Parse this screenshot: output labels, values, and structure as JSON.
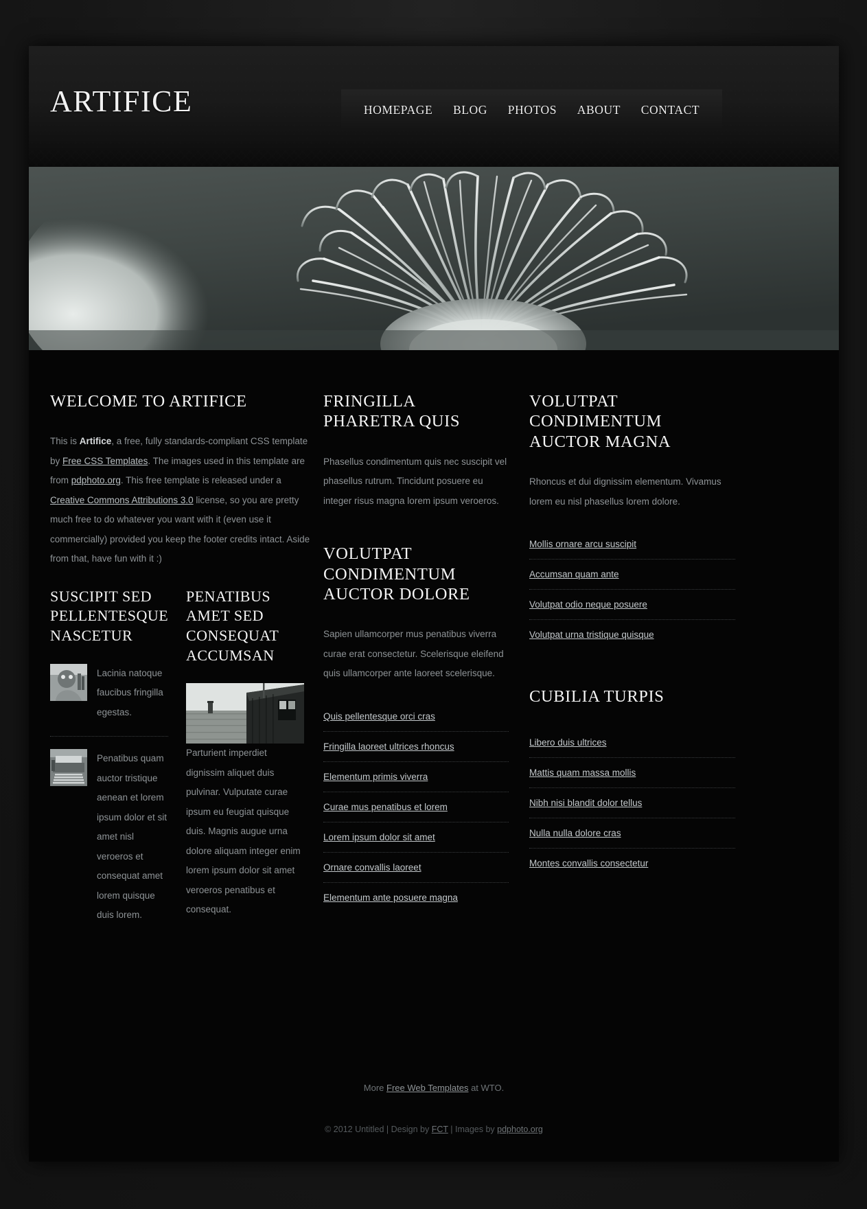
{
  "site": {
    "logo": "ARTIFICE"
  },
  "nav": {
    "items": [
      {
        "label": "HOMEPAGE"
      },
      {
        "label": "BLOG"
      },
      {
        "label": "PHOTOS"
      },
      {
        "label": "ABOUT"
      },
      {
        "label": "CONTACT"
      }
    ]
  },
  "banner": {
    "alt": "black and white macro photo of a pincushion protea flower"
  },
  "welcome": {
    "heading": "WELCOME TO ARTIFICE",
    "text_1": "This is ",
    "bold_1": "Artifice",
    "text_2": ", a free, fully standards-compliant CSS template by ",
    "link_1": "Free CSS Templates",
    "text_3": ". The images used in this template are from ",
    "link_2": "pdphoto.org",
    "text_4": ". This free template is released under a ",
    "link_3": "Creative Commons Attributions 3.0",
    "text_5": " license, so you are pretty much free to do whatever you want with it (even use it commercially) provided you keep the footer credits intact. Aside from that, have fun with it :)"
  },
  "left_blocks": [
    {
      "heading": "SUSCIPIT SED PELLENTESQUE NASCETUR",
      "items": [
        {
          "thumb": "statue-thumbnail",
          "text": "Lacinia natoque faucibus fringilla egestas."
        },
        {
          "thumb": "typewriter-thumbnail",
          "text": "Penatibus quam auctor tristique aenean et lorem ipsum dolor et sit amet nisl veroeros et consequat amet lorem quisque duis lorem."
        }
      ]
    },
    {
      "heading": "PENATIBUS AMET SED CONSEQUAT ACCUMSAN",
      "image": "barn-photo",
      "paragraph": "Parturient imperdiet dignissim aliquet duis pulvinar. Vulputate curae ipsum eu feugiat quisque duis. Magnis augue urna dolore aliquam integer enim lorem ipsum dolor sit amet veroeros penatibus et consequat."
    }
  ],
  "middle": {
    "block1": {
      "heading": "FRINGILLA PHARETRA QUIS",
      "paragraph": "Phasellus condimentum quis nec suscipit vel phasellus rutrum. Tincidunt posuere eu integer risus magna lorem ipsum veroeros."
    },
    "block2": {
      "heading": "VOLUTPAT CONDIMENTUM AUCTOR DOLORE",
      "paragraph": "Sapien ullamcorper mus penatibus viverra curae erat consectetur. Scelerisque eleifend quis ullamcorper ante laoreet scelerisque.",
      "links": [
        "Quis pellentesque orci cras",
        "Fringilla laoreet ultrices rhoncus",
        "Elementum primis viverra",
        "Curae mus penatibus et lorem",
        "Lorem ipsum dolor sit amet",
        "Ornare convallis laoreet",
        "Elementum ante posuere magna"
      ]
    }
  },
  "right": {
    "block1": {
      "heading": "VOLUTPAT CONDIMENTUM AUCTOR MAGNA",
      "paragraph": "Rhoncus et dui dignissim elementum. Vivamus lorem eu nisl phasellus lorem dolore.",
      "links": [
        "Mollis ornare arcu suscipit",
        "Accumsan quam ante",
        "Volutpat odio neque posuere",
        "Volutpat urna tristique quisque"
      ]
    },
    "block2": {
      "heading": "CUBILIA TURPIS",
      "links": [
        "Libero duis ultrices",
        "Mattis quam massa mollis",
        "Nibh nisi blandit dolor tellus",
        "Nulla nulla dolore cras",
        "Montes convallis consectetur"
      ]
    }
  },
  "footer": {
    "more_prefix": "More ",
    "more_link": "Free Web Templates",
    "more_suffix": " at WTO.",
    "copy_1": "© 2012 Untitled | Design by ",
    "copy_link_1": "FCT",
    "copy_2": " | Images by ",
    "copy_link_2": "pdphoto.org"
  },
  "colors": {
    "page_bg": "#050505",
    "outer_bg": "#1a1a1a",
    "heading": "#f4f4f4",
    "body_text": "#8e9396",
    "link": "#c4c9cc",
    "rule": "#3a3d3f"
  }
}
